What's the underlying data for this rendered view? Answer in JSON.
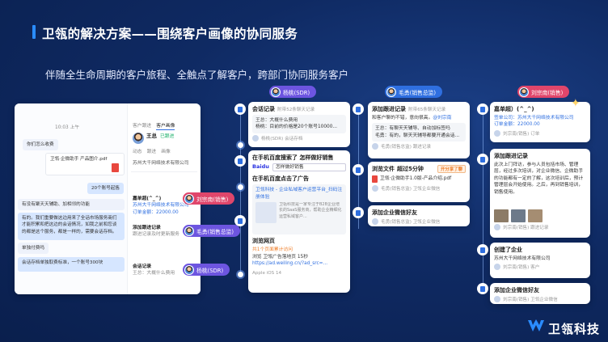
{
  "page": {
    "title": "卫瓴的解决方案——围绕客户画像的协同服务",
    "subtitle": "伴随全生命周期的客户旅程、全触点了解客户，跨部门协同服务客户",
    "brand": "卫瓴科技"
  },
  "pills": [
    {
      "label": "杨桃(SDR)"
    },
    {
      "label": "毛勇(销售总监)"
    },
    {
      "label": "刘宗南(销售)"
    },
    {
      "label": "刘宗南(销售)"
    },
    {
      "label": "毛勇(销售总监)"
    },
    {
      "label": "杨桃(SDR)"
    }
  ],
  "left_panel": {
    "tabs": [
      "客户跟进",
      "客户画像"
    ],
    "contact_name": "王总",
    "contact_tag": "已跟进",
    "tab_row": [
      "动态",
      "跟进",
      "画像"
    ],
    "company": "苏州大千网络技术有限公司",
    "chat_time": "10:03 上午",
    "msg1": "你们怎么收费",
    "file_name": "卫瓴·企微助手 产品图介.pdf",
    "msg2": "20个账号起售",
    "msg3": "有没有聚天天辅助、加相邻的功能",
    "msg4": "有的。我们重要做这边用来了全话市场服务商们才能积累和把这边的会话情况，如我之前和您谈的都是这个服务，都是一样的，需要会话存档。",
    "msg5": "单独付费吗",
    "msg6": "会话存档单独取费标准，一个账号300块",
    "side_rows": [
      {
        "name": "嘉单超(^_^)",
        "text": "苏州大千网络技术有限公司",
        "amount": "订单金额：22000.00"
      },
      {
        "name": "添加跟进记录",
        "text": "跟进记录及时更新服务",
        "amount": ""
      },
      {
        "name": "会话记录",
        "text": "王总：大概什么费用",
        "amount": ""
      }
    ]
  },
  "col1": {
    "card1": {
      "title": "会话记录",
      "meta": "附带52条聊天记录",
      "line1": "王总：大概什么费用",
      "line2": "杨桃：目前的价格是20个账号10000...",
      "footer": "杨桃(SDR)  会话存档"
    },
    "card2": {
      "title": "在手机百度搜索了 怎样做好销售",
      "search_text": "怎样做好销售",
      "baidu": "Baidu",
      "sub_title": "在手机百度点击了广告",
      "ad_title": "卫瓴科技 - 企业私域客户运营平台_扫码注册体验",
      "ad_desc": "卫瓴科技是一家专注于B2B企业增长的SaaS服务商，帮助企业精细化运营私域客户...",
      "page_title": "浏览网页",
      "page_meta": "共1个页面累计访问",
      "page_url": "浏览 卫瓴广告落地页 15秒",
      "page_link": "https://ad.weiling.cn/?ad_src=...",
      "footer": "Apple iOS 14"
    }
  },
  "col2": {
    "card1": {
      "title": "添加跟进记录",
      "meta": "附带65条聊天记录",
      "line1": "和客户聊的不错，意向很高。",
      "mention": "@刘宗南",
      "line2": "王总：有聊天天辅导、自动加标签吗",
      "line3": "毛勇：有的，聊天天辅导都要开通会话...",
      "footer": "毛勇(销售总监)  跟进记录"
    },
    "card2": {
      "title": "浏览文件",
      "meta": "超过5分钟",
      "tag": "开分享了聊",
      "file": "卫瓴·企微助手1.0版-产品介绍.pdf",
      "footer": "毛勇(销售总监)  卫瓴企业微信"
    },
    "card3": {
      "title": "添加企业微信好友",
      "footer": "毛勇(销售总监)  卫瓴企业微信"
    }
  },
  "col3": {
    "card1": {
      "title": "嘉单超）(^_^)",
      "line1": "签单公司：苏州大千网络技术有限公司",
      "line2": "订单金额：22000.00",
      "footer": "刘宗南(销售)  订单"
    },
    "card2": {
      "title": "添加跟进记录",
      "text": "此次上门拜访，参与人员包括市场、管理层，经过多次培训，对企业微信、企微助手的功能都有一定的了解，这次培训后，预计管理层会开始使用。之后，再到销售培训，销售使用。",
      "footer": "刘宗南(销售)  跟进记录"
    },
    "card3": {
      "title": "创建了企业",
      "company": "苏州大千网络技术有限公司",
      "footer": "刘宗南(销售)  客户"
    },
    "card4": {
      "title": "添加企业微信好友",
      "footer": "刘宗南(销售)  卫瓴企业微信"
    }
  }
}
